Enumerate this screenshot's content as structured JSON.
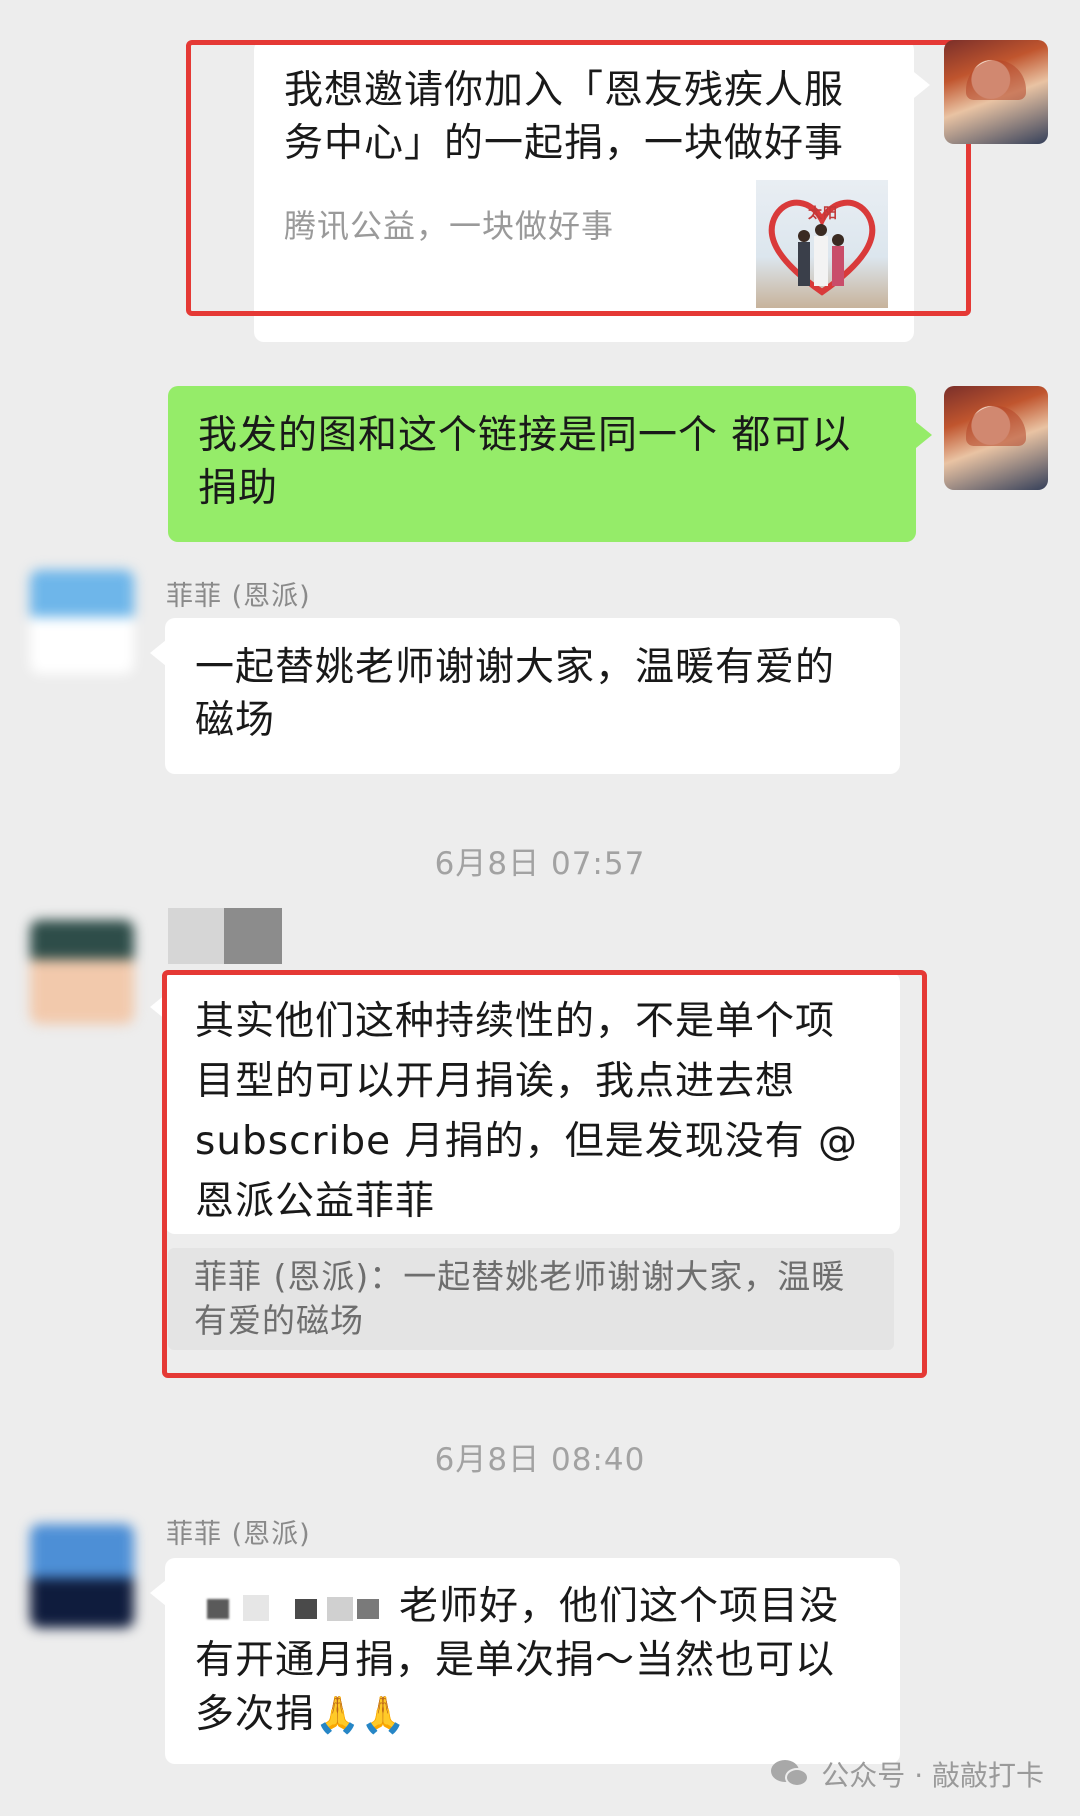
{
  "share_card": {
    "title": "我想邀请你加入「恩友残疾人服务中心」的一起捐，一块做好事",
    "title_line1": "我想邀请你加入「恩友残疾人服",
    "title_line2": "务中心」的一起捐，一块做好事",
    "source": "腾讯公益，一块做好事",
    "thumb_text": "太阳"
  },
  "messages": [
    {
      "sender": "",
      "line1": "我发的图和这个链接是同一个 都可以",
      "line2": "捐助"
    },
    {
      "sender": "菲菲 (恩派)",
      "line1": "一起替姚老师谢谢大家，温暖有爱的",
      "line2": "磁场"
    },
    {
      "sender": "",
      "line1": "其实他们这种持续性的，不是单个项",
      "line2": "目型的可以开月捐诶，我点进去想",
      "line3": "subscribe 月捐的，但是发现没有 @",
      "line4": "恩派公益菲菲",
      "quote_line1": "菲菲 (恩派)：一起替姚老师谢谢大家，温暖",
      "quote_line2": "有爱的磁场"
    },
    {
      "sender": "菲菲 (恩派)",
      "line1": "老师好，他们这个项目没",
      "line2": "有开通月捐，是单次捐～当然也可以",
      "line3": "多次捐",
      "emoji": "🙏🙏"
    }
  ],
  "timestamps": [
    "6月8日 07:57",
    "6月8日 08:40"
  ],
  "footer": {
    "text": "公众号 · 敲敲打卡"
  },
  "colors": {
    "background": "#ededed",
    "bubble_self": "#95ec69",
    "bubble_other": "#ffffff",
    "highlight_border": "#e53935"
  }
}
